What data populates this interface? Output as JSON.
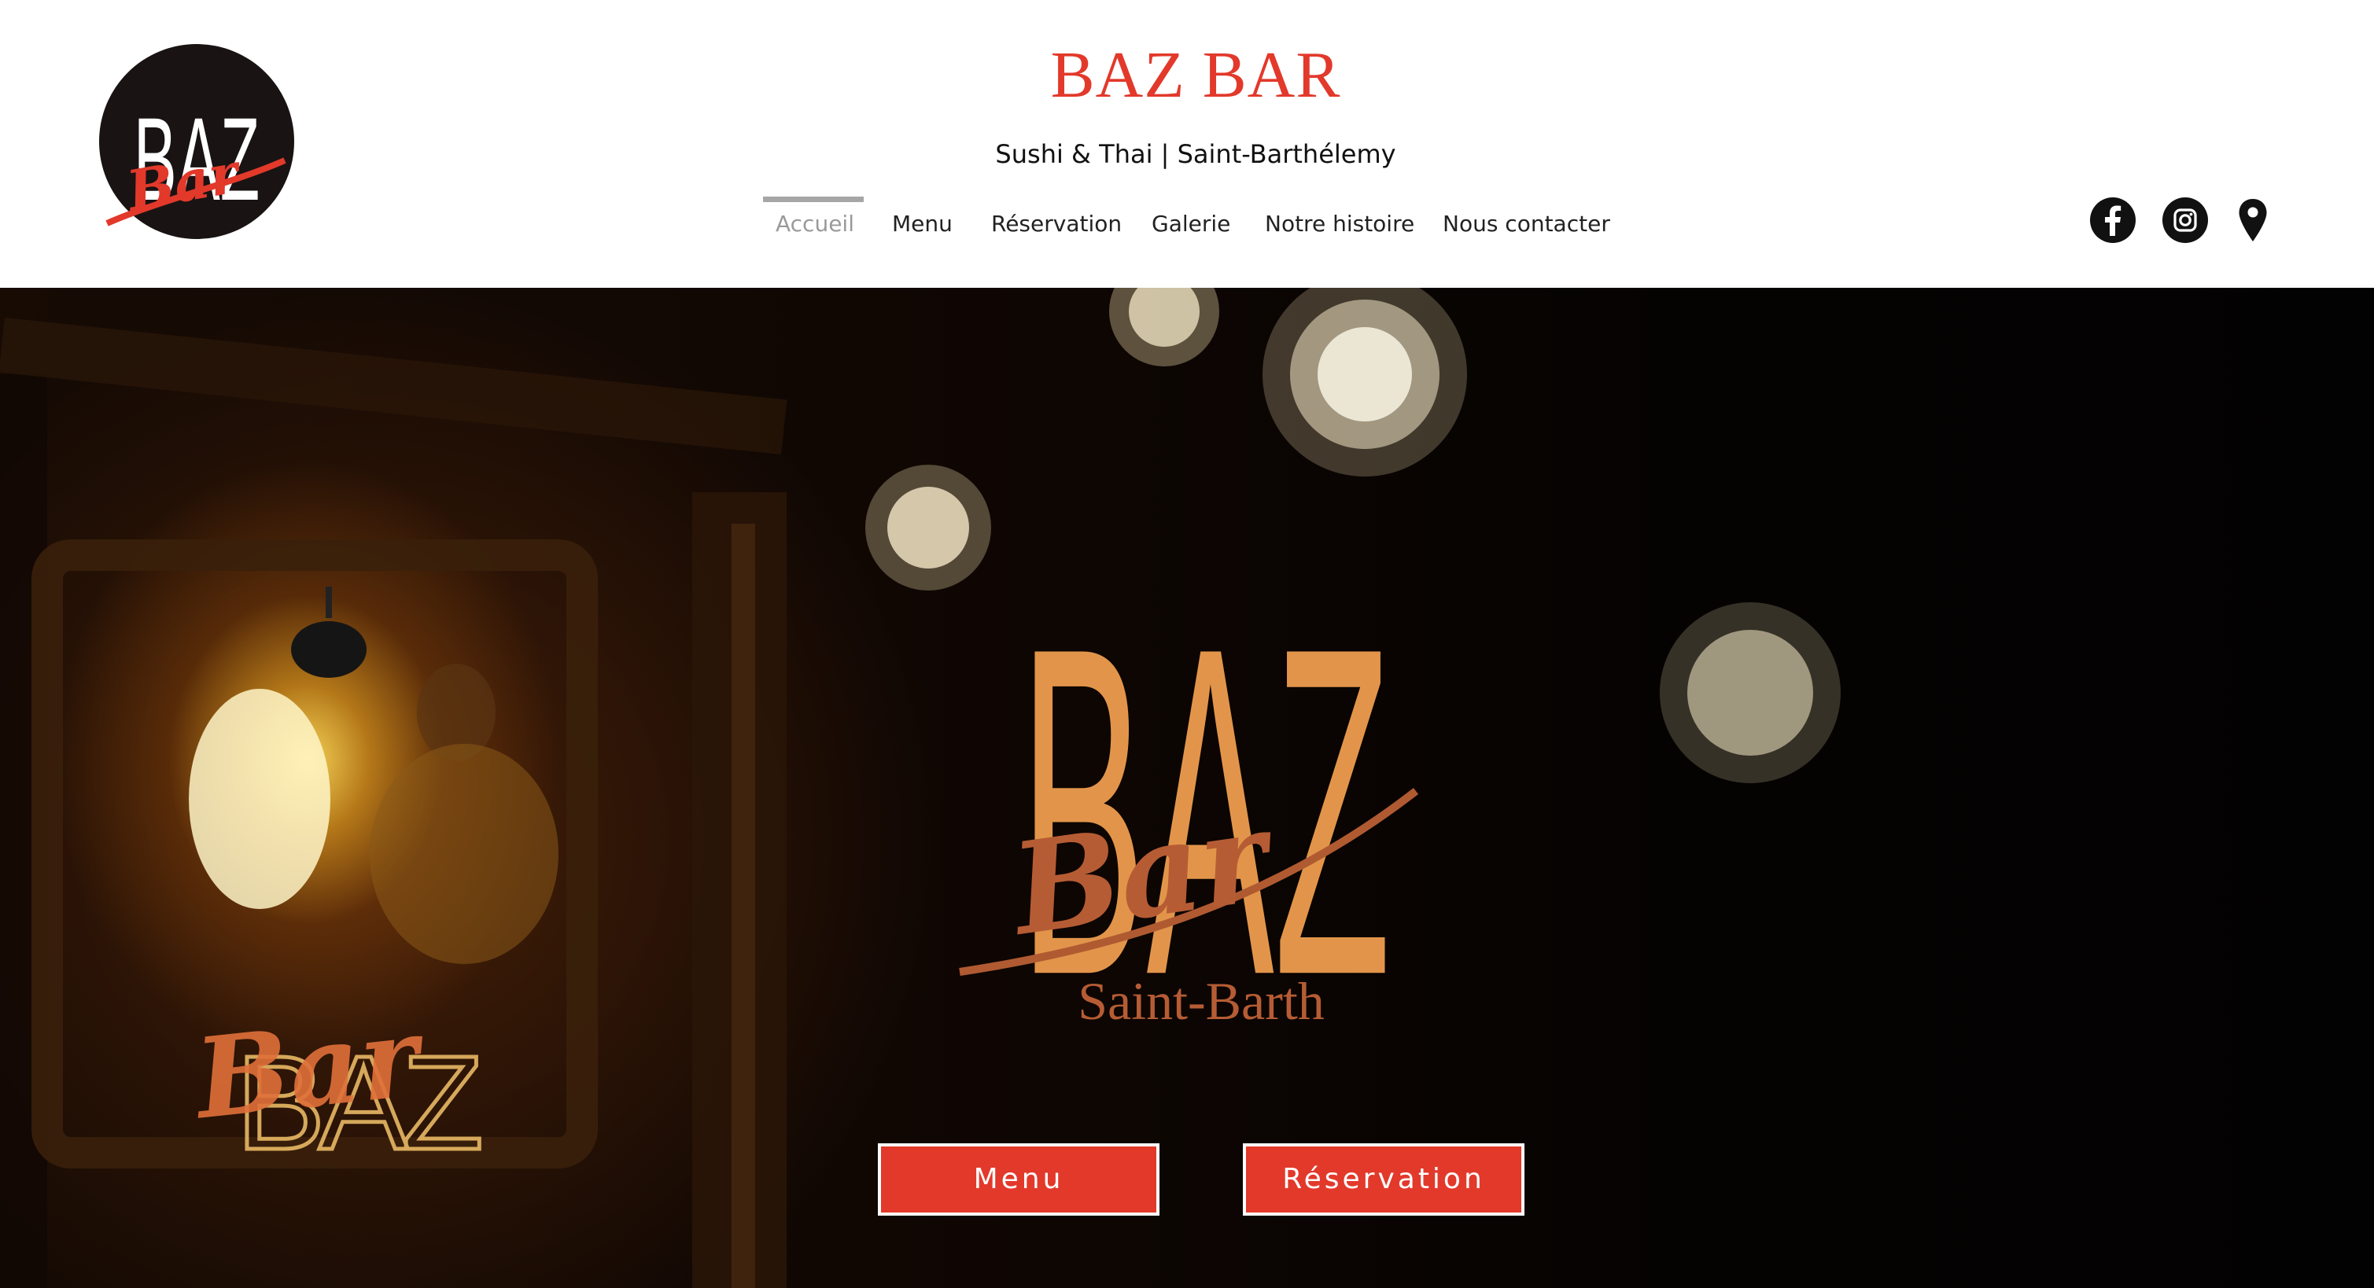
{
  "header": {
    "title": "BAZ BAR",
    "subtitle": "Sushi & Thai | Saint-Barthélemy",
    "logo": {
      "text_top": "BAZ",
      "text_script": "Bar"
    }
  },
  "nav": {
    "items": [
      {
        "label": "Accueil",
        "active": true
      },
      {
        "label": "Menu"
      },
      {
        "label": "Réservation"
      },
      {
        "label": "Galerie"
      },
      {
        "label": "Notre histoire"
      },
      {
        "label": "Nous contacter"
      }
    ]
  },
  "social": [
    {
      "icon": "facebook-icon"
    },
    {
      "icon": "instagram-icon"
    },
    {
      "icon": "map-pin-icon"
    }
  ],
  "hero": {
    "logo_text_top": "BAZ",
    "logo_text_script": "Bar",
    "logo_text_bottom": "Saint-Barth",
    "sign_text_top": "BAZ",
    "sign_text_script": "Bar",
    "buttons": {
      "menu": "Menu",
      "reservation": "Réservation"
    }
  },
  "colors": {
    "accent": "#e2392b",
    "hero_logo": "#e2954a",
    "nav_active": "#9a9a9a"
  }
}
